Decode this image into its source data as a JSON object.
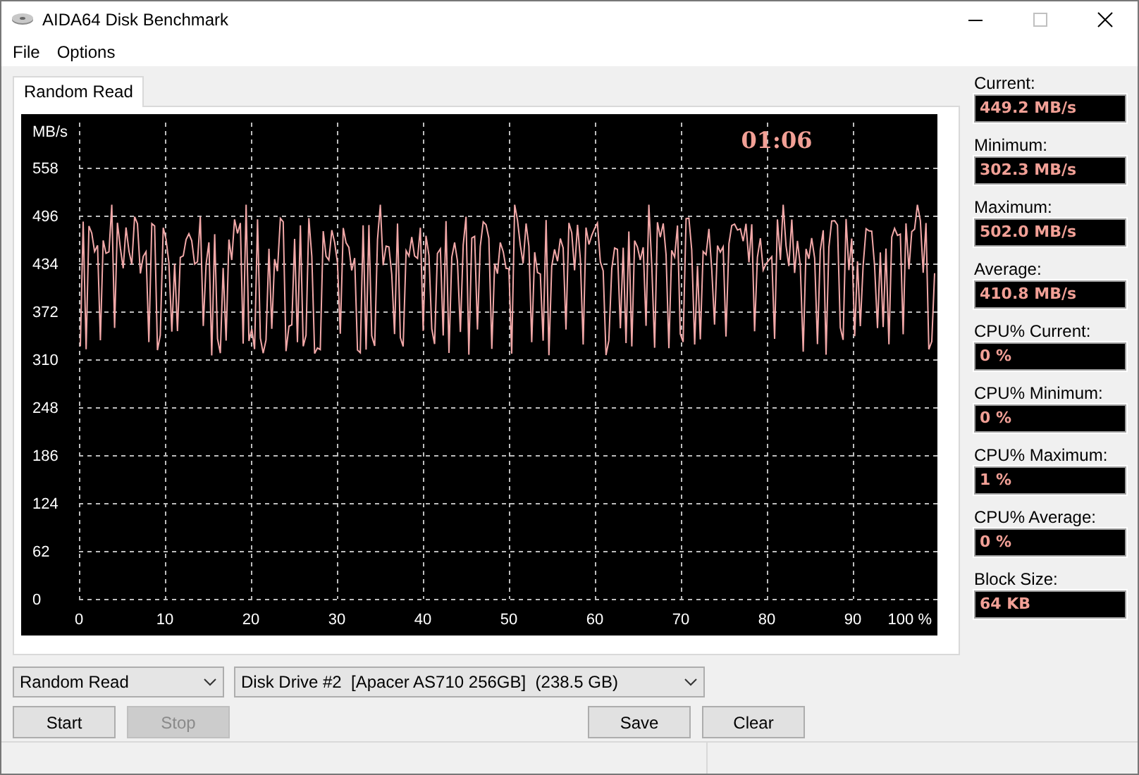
{
  "window": {
    "title": "AIDA64 Disk Benchmark"
  },
  "menu": [
    "File",
    "Options"
  ],
  "tabs": [
    {
      "label": "Random Read",
      "selected": true
    }
  ],
  "chart": {
    "unit": "MB/s",
    "timer": "01:06",
    "yticks": [
      "558",
      "496",
      "434",
      "372",
      "310",
      "248",
      "186",
      "124",
      "62",
      "0"
    ],
    "xticks": [
      "0",
      "10",
      "20",
      "30",
      "40",
      "50",
      "60",
      "70",
      "80",
      "90",
      "100 %"
    ]
  },
  "stats": [
    {
      "label": "Current:",
      "value": "449.2 MB/s"
    },
    {
      "label": "Minimum:",
      "value": "302.3 MB/s"
    },
    {
      "label": "Maximum:",
      "value": "502.0 MB/s"
    },
    {
      "label": "Average:",
      "value": "410.8 MB/s"
    },
    {
      "label": "CPU% Current:",
      "value": "0 %"
    },
    {
      "label": "CPU% Minimum:",
      "value": "0 %"
    },
    {
      "label": "CPU% Maximum:",
      "value": "1 %"
    },
    {
      "label": "CPU% Average:",
      "value": "0 %"
    },
    {
      "label": "Block Size:",
      "value": "64 KB"
    }
  ],
  "test_select": {
    "value": "Random Read"
  },
  "drive_select": {
    "value": "Disk Drive #2  [Apacer AS710 256GB]  (238.5 GB)"
  },
  "run_buttons": [
    {
      "label": "Start",
      "disabled": false
    },
    {
      "label": "Stop",
      "disabled": true
    }
  ],
  "file_buttons": [
    {
      "label": "Save",
      "disabled": false
    },
    {
      "label": "Clear",
      "disabled": false
    }
  ]
}
